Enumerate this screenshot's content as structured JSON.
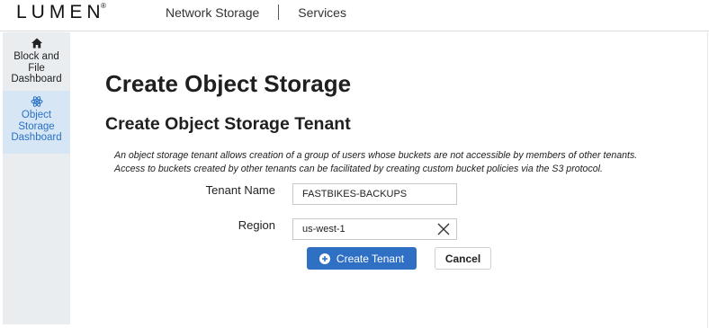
{
  "header": {
    "logo_text": "LUMEN",
    "logo_mark": "®",
    "nav": [
      {
        "label": "Network Storage"
      },
      {
        "label": "Services"
      }
    ]
  },
  "sidebar": {
    "items": [
      {
        "label_lines": [
          "Block and",
          "File",
          "Dashboard"
        ],
        "icon": "home-icon",
        "active": false
      },
      {
        "label_lines": [
          "Object",
          "Storage",
          "Dashboard"
        ],
        "icon": "atom-icon",
        "active": true
      }
    ]
  },
  "main": {
    "title": "Create Object Storage",
    "subtitle": "Create Object Storage Tenant",
    "description_lines": [
      "An object storage tenant allows creation of a group of users whose buckets are not accessible by members of other tenants.",
      "Access to buckets created by other tenants can be facilitated by creating custom bucket policies via the S3 protocol."
    ],
    "form": {
      "tenant_name_label": "Tenant Name",
      "tenant_name_value": "FASTBIKES-BACKUPS",
      "region_label": "Region",
      "region_value": "us-west-1",
      "create_button": "Create Tenant",
      "cancel_button": "Cancel"
    }
  },
  "colors": {
    "primary": "#2f6fc4",
    "sidebar_bg": "#e9edf0",
    "sidebar_active_bg": "#d6e6f5",
    "sidebar_active_text": "#2b72c4"
  }
}
